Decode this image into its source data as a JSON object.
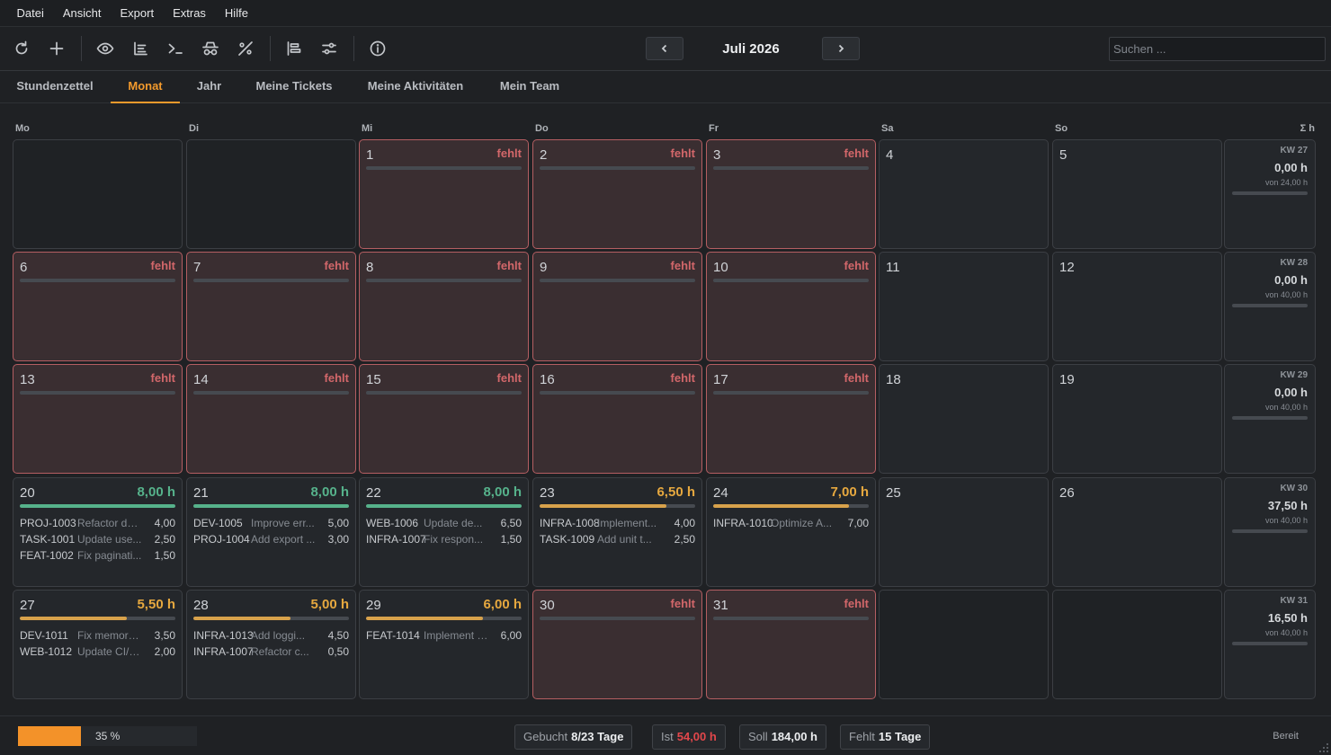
{
  "menu": [
    "Datei",
    "Ansicht",
    "Export",
    "Extras",
    "Hilfe"
  ],
  "toolbar": {
    "icons": [
      "refresh-icon",
      "plus-icon",
      "eye-icon",
      "list-icon",
      "terminal-icon",
      "incognito-icon",
      "percent-icon",
      "align-left-icon",
      "sliders-icon",
      "info-icon"
    ],
    "month_title": "Juli 2026",
    "search_placeholder": "Suchen ..."
  },
  "tabs": [
    "Stundenzettel",
    "Monat",
    "Jahr",
    "Meine Tickets",
    "Meine Aktivitäten",
    "Mein Team"
  ],
  "active_tab": "Monat",
  "day_headers": [
    "Mo",
    "Di",
    "Mi",
    "Do",
    "Fr",
    "Sa",
    "So",
    "Σ h"
  ],
  "missing_label": "fehlt",
  "weeks": [
    {
      "days": [
        {
          "day": ""
        },
        {
          "day": ""
        },
        {
          "day": "1",
          "missing": true
        },
        {
          "day": "2",
          "missing": true
        },
        {
          "day": "3",
          "missing": true
        },
        {
          "day": "4"
        },
        {
          "day": "5"
        }
      ],
      "summary": {
        "kw": "KW 27",
        "total": "0,00 h",
        "target": "von 24,00 h",
        "progress": 0
      }
    },
    {
      "days": [
        {
          "day": "6",
          "missing": true
        },
        {
          "day": "7",
          "missing": true
        },
        {
          "day": "8",
          "missing": true
        },
        {
          "day": "9",
          "missing": true
        },
        {
          "day": "10",
          "missing": true
        },
        {
          "day": "11"
        },
        {
          "day": "12"
        }
      ],
      "summary": {
        "kw": "KW 28",
        "total": "0,00 h",
        "target": "von 40,00 h",
        "progress": 0
      }
    },
    {
      "days": [
        {
          "day": "13",
          "missing": true
        },
        {
          "day": "14",
          "missing": true
        },
        {
          "day": "15",
          "missing": true
        },
        {
          "day": "16",
          "missing": true
        },
        {
          "day": "17",
          "missing": true
        },
        {
          "day": "18"
        },
        {
          "day": "19"
        }
      ],
      "summary": {
        "kw": "KW 29",
        "total": "0,00 h",
        "target": "von 40,00 h",
        "progress": 0
      }
    },
    {
      "days": [
        {
          "day": "20",
          "hours": "8,00 h",
          "color": "green",
          "progress": 1.0,
          "entries": [
            {
              "ticket": "PROJ-1003",
              "desc": "Refactor da...",
              "hours": "4,00"
            },
            {
              "ticket": "TASK-1001",
              "desc": "Update use...",
              "hours": "2,50"
            },
            {
              "ticket": "FEAT-1002",
              "desc": "Fix paginati...",
              "hours": "1,50"
            }
          ]
        },
        {
          "day": "21",
          "hours": "8,00 h",
          "color": "green",
          "progress": 1.0,
          "entries": [
            {
              "ticket": "DEV-1005",
              "desc": "Improve err...",
              "hours": "5,00"
            },
            {
              "ticket": "PROJ-1004",
              "desc": "Add export ...",
              "hours": "3,00"
            }
          ]
        },
        {
          "day": "22",
          "hours": "8,00 h",
          "color": "green",
          "progress": 1.0,
          "entries": [
            {
              "ticket": "WEB-1006",
              "desc": "Update de...",
              "hours": "6,50"
            },
            {
              "ticket": "INFRA-1007",
              "desc": "Fix respon...",
              "hours": "1,50"
            }
          ]
        },
        {
          "day": "23",
          "hours": "6,50 h",
          "color": "orange",
          "progress": 0.8125,
          "entries": [
            {
              "ticket": "INFRA-1008",
              "desc": "Implement...",
              "hours": "4,00"
            },
            {
              "ticket": "TASK-1009",
              "desc": "Add unit t...",
              "hours": "2,50"
            }
          ]
        },
        {
          "day": "24",
          "hours": "7,00 h",
          "color": "orange",
          "progress": 0.875,
          "entries": [
            {
              "ticket": "INFRA-1010",
              "desc": "Optimize A...",
              "hours": "7,00"
            }
          ]
        },
        {
          "day": "25"
        },
        {
          "day": "26"
        }
      ],
      "summary": {
        "kw": "KW 30",
        "total": "37,50 h",
        "target": "von 40,00 h",
        "progress": 0.9375
      }
    },
    {
      "days": [
        {
          "day": "27",
          "hours": "5,50 h",
          "color": "orange",
          "progress": 0.6875,
          "entries": [
            {
              "ticket": "DEV-1011",
              "desc": "Fix memory l...",
              "hours": "3,50"
            },
            {
              "ticket": "WEB-1012",
              "desc": "Update CI/C...",
              "hours": "2,00"
            }
          ]
        },
        {
          "day": "28",
          "hours": "5,00 h",
          "color": "orange",
          "progress": 0.625,
          "entries": [
            {
              "ticket": "INFRA-1013",
              "desc": "Add loggi...",
              "hours": "4,50"
            },
            {
              "ticket": "INFRA-1007",
              "desc": "Refactor c...",
              "hours": "0,50"
            }
          ]
        },
        {
          "day": "29",
          "hours": "6,00 h",
          "color": "orange",
          "progress": 0.75,
          "entries": [
            {
              "ticket": "FEAT-1014",
              "desc": "Implement r...",
              "hours": "6,00"
            }
          ]
        },
        {
          "day": "30",
          "missing": true
        },
        {
          "day": "31",
          "missing": true
        },
        {
          "day": ""
        },
        {
          "day": ""
        }
      ],
      "summary": {
        "kw": "KW 31",
        "total": "16,50 h",
        "target": "von 40,00 h",
        "progress": 0.4125
      }
    }
  ],
  "statusbar": {
    "progress_percent": 35,
    "progress_label": "35 %",
    "chips": [
      {
        "label": "Gebucht",
        "value": "8/23 Tage"
      },
      {
        "label": "Ist",
        "value": "54,00 h",
        "alert": true
      },
      {
        "label": "Soll",
        "value": "184,00 h"
      },
      {
        "label": "Fehlt",
        "value": "15 Tage"
      }
    ],
    "status": "Bereit"
  },
  "colors": {
    "accent": "#f39a2c",
    "missing_border": "#b45e62",
    "missing_bg": "#3a2e31",
    "done": "#56b28b",
    "partial": "#d8a24b",
    "alert": "#e2474b"
  }
}
